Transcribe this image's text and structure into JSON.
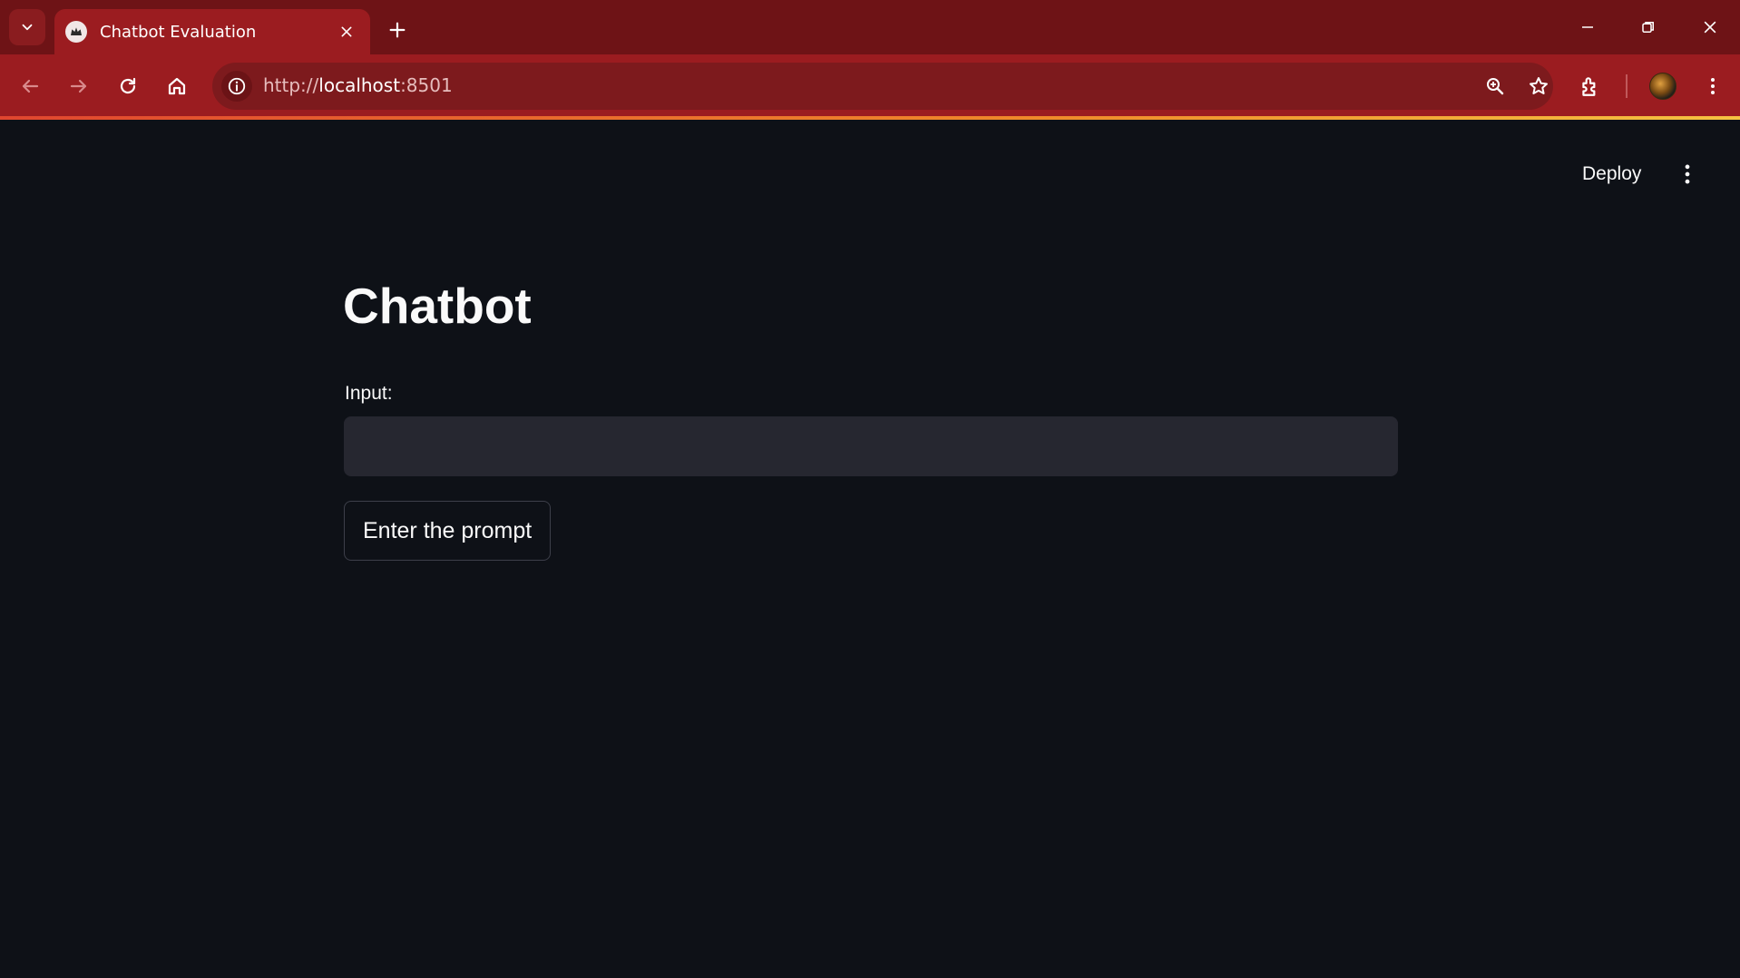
{
  "browser": {
    "tab_title": "Chatbot Evaluation",
    "url_scheme": "http://",
    "url_host": "localhost",
    "url_port": ":8501",
    "theme_color": "#9b1c20"
  },
  "app": {
    "header": {
      "deploy_label": "Deploy"
    },
    "title": "Chatbot",
    "input": {
      "label": "Input:",
      "value": "",
      "placeholder": ""
    },
    "submit_label": "Enter the prompt",
    "background": "#0e1117"
  }
}
